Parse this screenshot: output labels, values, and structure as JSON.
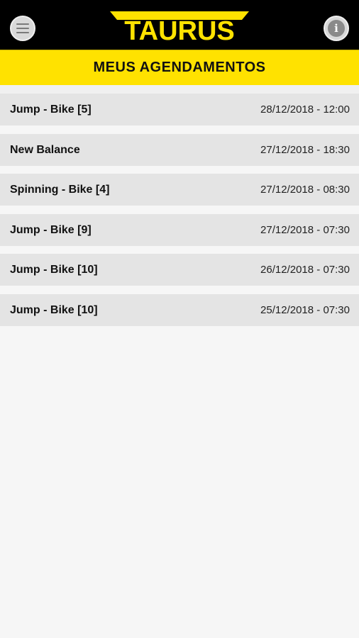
{
  "header": {
    "brand": "TAURUS",
    "menu_icon": "hamburger-menu-icon",
    "info_icon": "info-icon",
    "brand_color": "#FFE200"
  },
  "title": "MEUS AGENDAMENTOS",
  "appointments": [
    {
      "name": "Jump - Bike [5]",
      "datetime": "28/12/2018 - 12:00"
    },
    {
      "name": "New Balance",
      "datetime": "27/12/2018 - 18:30"
    },
    {
      "name": "Spinning - Bike [4]",
      "datetime": "27/12/2018 - 08:30"
    },
    {
      "name": "Jump - Bike [9]",
      "datetime": "27/12/2018 - 07:30"
    },
    {
      "name": "Jump - Bike [10]",
      "datetime": "26/12/2018 - 07:30"
    },
    {
      "name": "Jump - Bike [10]",
      "datetime": "25/12/2018 - 07:30"
    }
  ]
}
